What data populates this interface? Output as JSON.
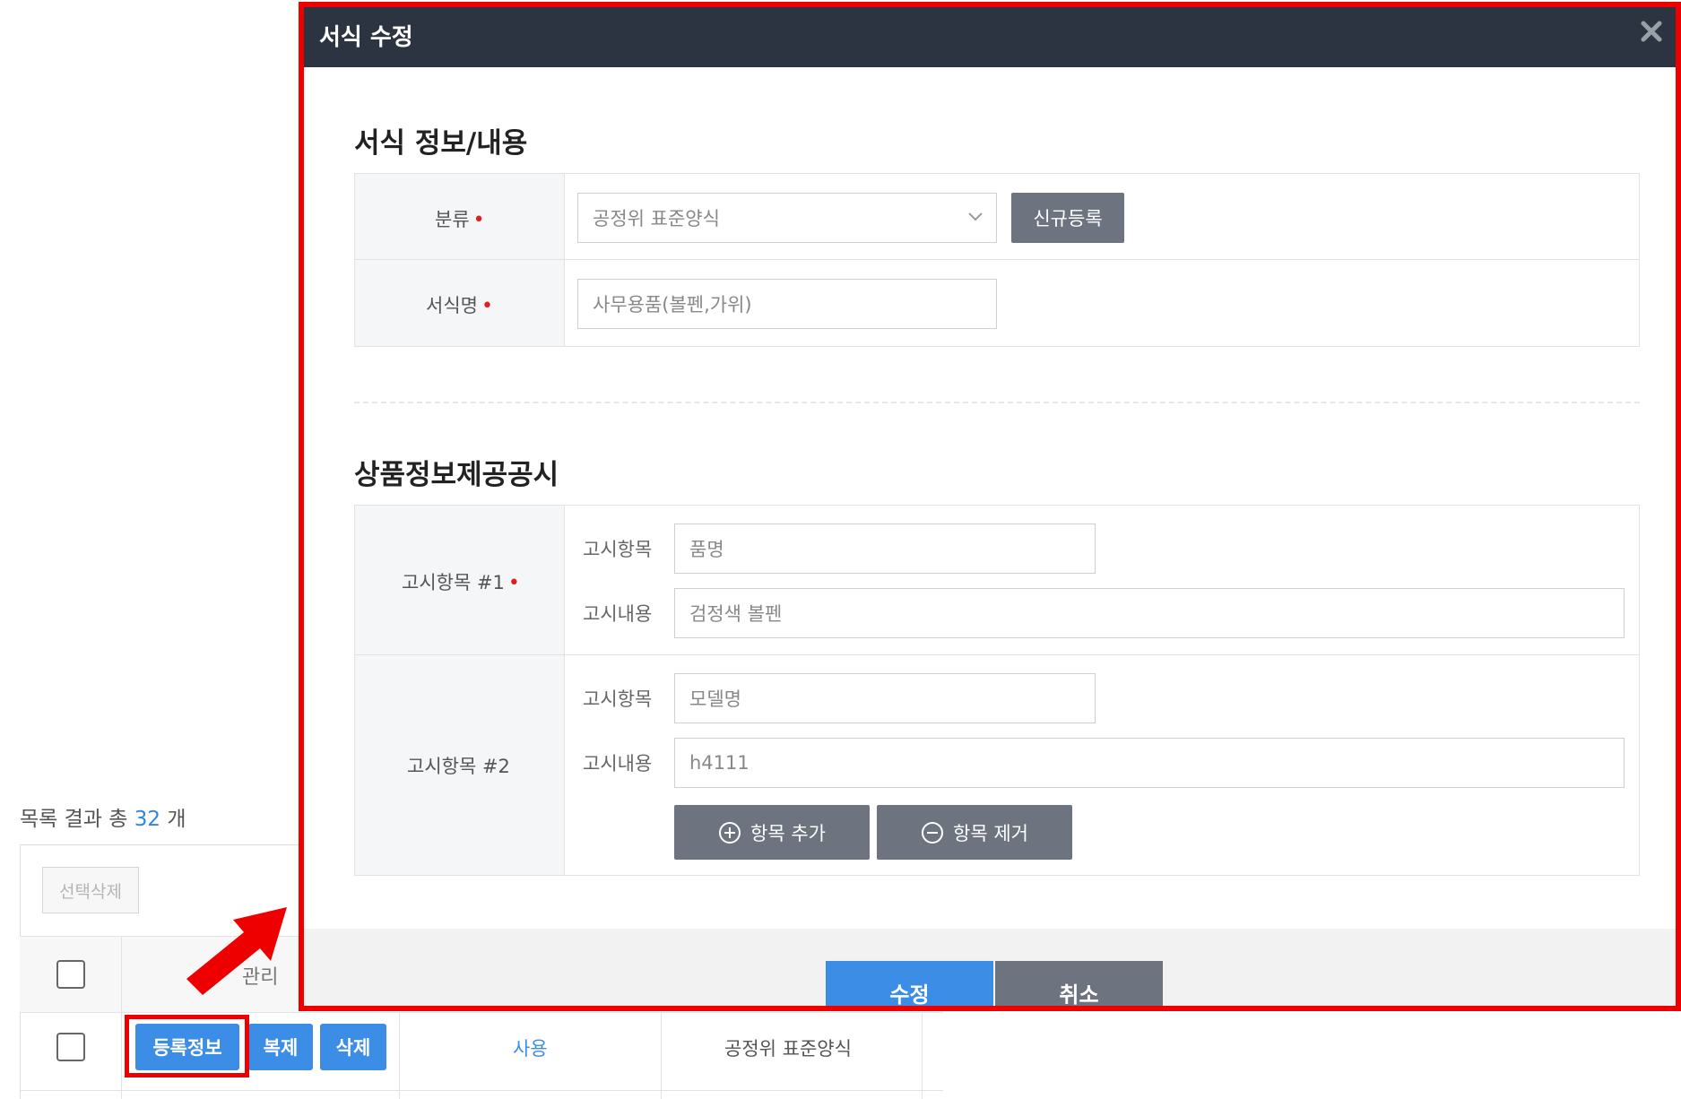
{
  "background": {
    "result_prefix": "목록 결과 총",
    "result_count": "32",
    "result_suffix": "개",
    "select_delete_label": "선택삭제",
    "column_manage": "관리",
    "row": {
      "register_info_label": "등록정보",
      "copy_label": "복제",
      "delete_label": "삭제",
      "status": "사용",
      "category": "공정위 표준양식"
    }
  },
  "modal": {
    "title": "서식 수정",
    "section1_title": "서식 정보/내용",
    "category_label": "분류",
    "category_value": "공정위 표준양식",
    "new_register_label": "신규등록",
    "form_name_label": "서식명",
    "form_name_value": "사무용품(볼펜,가위)",
    "section2_title": "상품정보제공공시",
    "notice_items": [
      {
        "label": "고시항목 #1",
        "item_label": "고시항목",
        "item_value": "품명",
        "content_label": "고시내용",
        "content_value": "검정색 볼펜"
      },
      {
        "label": "고시항목 #2",
        "item_label": "고시항목",
        "item_value": "모델명",
        "content_label": "고시내용",
        "content_value": "h4111"
      }
    ],
    "add_item_label": "항목 추가",
    "remove_item_label": "항목 제거",
    "save_label": "수정",
    "cancel_label": "취소"
  },
  "colors": {
    "header_bg": "#2c3441",
    "primary": "#3c8de6",
    "gray_button": "#6d7480",
    "annotation_red": "#ee0000",
    "required_dot": "#e31c1c"
  }
}
